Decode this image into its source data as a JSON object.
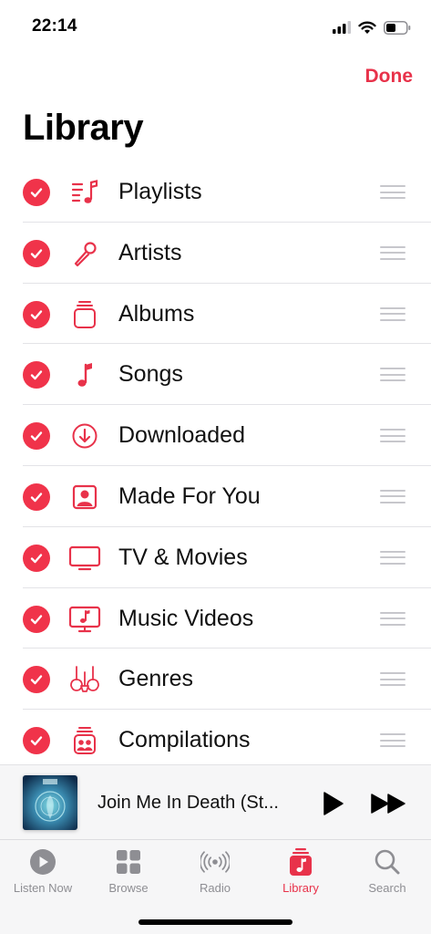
{
  "status_bar": {
    "time": "22:14"
  },
  "header": {
    "done_label": "Done",
    "title": "Library"
  },
  "library_items": [
    {
      "label": "Playlists",
      "icon": "playlists-icon",
      "checked": true
    },
    {
      "label": "Artists",
      "icon": "microphone-icon",
      "checked": true
    },
    {
      "label": "Albums",
      "icon": "album-stack-icon",
      "checked": true
    },
    {
      "label": "Songs",
      "icon": "music-note-icon",
      "checked": true
    },
    {
      "label": "Downloaded",
      "icon": "download-circle-icon",
      "checked": true
    },
    {
      "label": "Made For You",
      "icon": "person-square-icon",
      "checked": true
    },
    {
      "label": "TV & Movies",
      "icon": "tv-icon",
      "checked": true
    },
    {
      "label": "Music Videos",
      "icon": "music-video-icon",
      "checked": true
    },
    {
      "label": "Genres",
      "icon": "guitars-icon",
      "checked": true
    },
    {
      "label": "Compilations",
      "icon": "compilation-icon",
      "checked": true
    }
  ],
  "mini_player": {
    "track_title": "Join Me In Death (St..."
  },
  "tabs": [
    {
      "label": "Listen Now",
      "icon": "play-circle-icon",
      "active": false
    },
    {
      "label": "Browse",
      "icon": "grid-icon",
      "active": false
    },
    {
      "label": "Radio",
      "icon": "radio-waves-icon",
      "active": false
    },
    {
      "label": "Library",
      "icon": "library-icon",
      "active": true
    },
    {
      "label": "Search",
      "icon": "magnifier-icon",
      "active": false
    }
  ],
  "colors": {
    "accent": "#e8324a",
    "inactive_tab": "#8e8e93",
    "separator": "#e3e3e7"
  }
}
